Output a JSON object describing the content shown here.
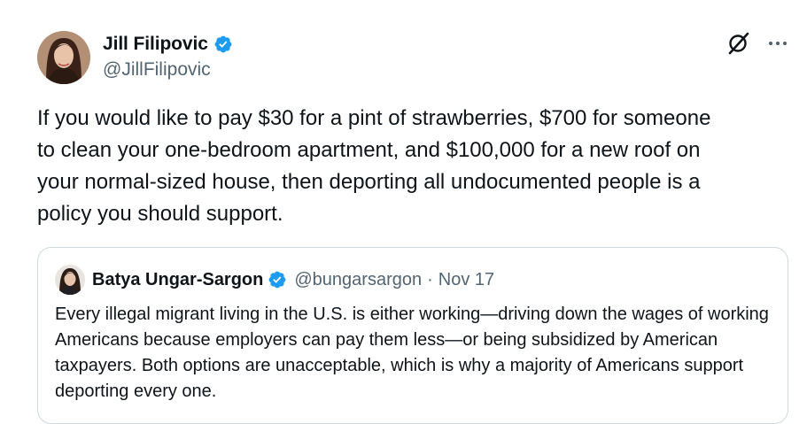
{
  "author": {
    "display_name": "Jill Filipovic",
    "handle": "@JillFilipovic",
    "verified": true,
    "avatar_icon": "profile-photo"
  },
  "actions": {
    "grok_icon": "grok-icon",
    "more_icon": "more-icon"
  },
  "tweet": {
    "text": "If you would like to pay $30 for a pint of strawberries, $700 for someone\nto clean your one-bedroom apartment, and $100,000 for a new roof on\nyour normal-sized house, then deporting all undocumented people is a\npolicy you should support."
  },
  "quote": {
    "display_name": "Batya Ungar-Sargon",
    "handle": "@bungarsargon",
    "separator": "·",
    "date": "Nov 17",
    "verified": true,
    "text": "Every illegal migrant living in the U.S. is either working—driving down the wages of working Americans because employers can pay them less—or being subsidized by American taxpayers. Both options are unacceptable, which is why a majority of Americans support deporting every one."
  },
  "colors": {
    "text_primary": "#0f1419",
    "text_secondary": "#536471",
    "verified_blue": "#1d9bf0",
    "border": "#cfd9de"
  }
}
